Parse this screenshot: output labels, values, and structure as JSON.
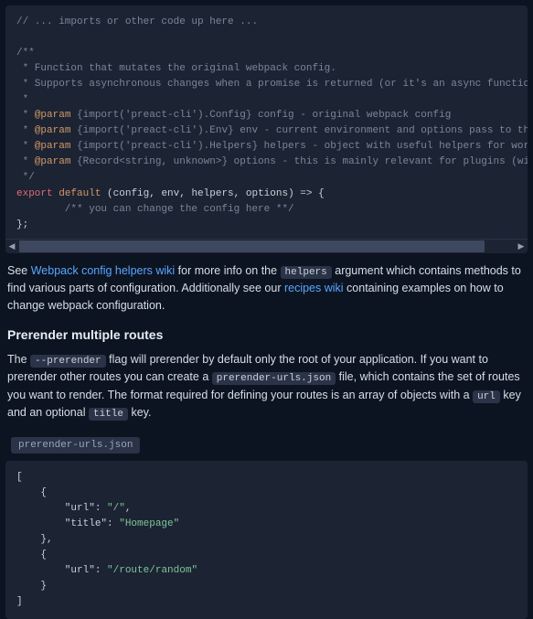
{
  "code1": {
    "line1": "// ... imports or other code up here ...",
    "line2": "/**",
    "line3": " * Function that mutates the original webpack config.",
    "line4": " * Supports asynchronous changes when a promise is returned (or it's an async function).",
    "line5": " *",
    "line6a": " * ",
    "tag6": "@param",
    "line6b": " {import('preact-cli').Config} config - original webpack config",
    "line7a": " * ",
    "tag7": "@param",
    "line7b": " {import('preact-cli').Env} env - current environment and options pass to the CLI",
    "line8a": " * ",
    "tag8": "@param",
    "line8b": " {import('preact-cli').Helpers} helpers - object with useful helpers for working with the webpack config",
    "line9a": " * ",
    "tag9": "@param",
    "line9b": " {Record<string, unknown>} options - this is mainly relevant for plugins (will always be empty in the config)",
    "line10": " */",
    "kw_export": "export",
    "kw_default": "default",
    "fn_sig": " (config, env, helpers, options) => {",
    "line12": "        /** you can change the config here **/",
    "line13": "};"
  },
  "scroll": {
    "thumb_width_pct": 94
  },
  "para1": {
    "t1": "See ",
    "link1": "Webpack config helpers wiki",
    "t2": " for more info on the ",
    "code1": "helpers",
    "t3": " argument which contains methods to find various parts of configuration. Additionally see our ",
    "link2": "recipes wiki",
    "t4": " containing examples on how to change webpack configuration."
  },
  "section_title": "Prerender multiple routes",
  "para2": {
    "t1": "The ",
    "code1": "--prerender",
    "t2": " flag will prerender by default only the root of your application. If you want to prerender other routes you can create a ",
    "code2": "prerender-urls.json",
    "t3": " file, which contains the set of routes you want to render. The format required for defining your routes is an array of objects with a ",
    "code3": "url",
    "t4": " key and an optional ",
    "code4": "title",
    "t5": " key."
  },
  "filename": "prerender-urls.json",
  "json": {
    "ob": "[",
    "l1": "    {",
    "l2a": "        \"url\": ",
    "l2b": "\"/\"",
    "l2c": ",",
    "l3a": "        \"title\": ",
    "l3b": "\"Homepage\"",
    "l4": "    },",
    "l5": "    {",
    "l6a": "        \"url\": ",
    "l6b": "\"/route/random\"",
    "l7": "    }",
    "cb": "]"
  }
}
